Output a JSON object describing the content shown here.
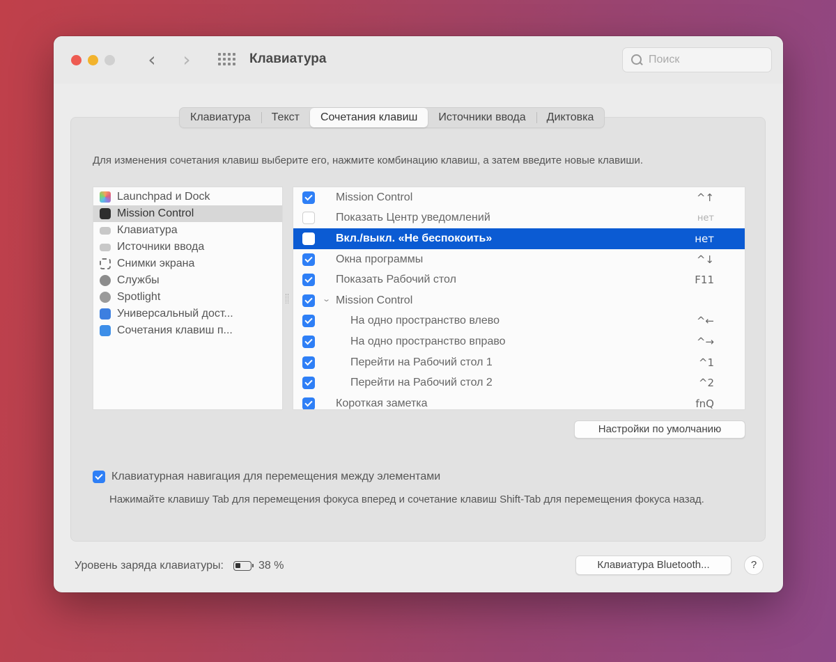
{
  "window": {
    "title": "Клавиатура",
    "search_placeholder": "Поиск"
  },
  "tabs": [
    {
      "label": "Клавиатура",
      "active": false
    },
    {
      "label": "Текст",
      "active": false
    },
    {
      "label": "Сочетания клавиш",
      "active": true
    },
    {
      "label": "Источники ввода",
      "active": false
    },
    {
      "label": "Диктовка",
      "active": false
    }
  ],
  "instructions": "Для изменения сочетания клавиш выберите его, нажмите комбинацию клавиш, а затем введите новые клавиши.",
  "sidebar": {
    "items": [
      {
        "label": "Launchpad и Dock",
        "icon": "launchpad-icon",
        "selected": false
      },
      {
        "label": "Mission Control",
        "icon": "mission-control-icon",
        "selected": true
      },
      {
        "label": "Клавиатура",
        "icon": "keyboard-icon",
        "selected": false
      },
      {
        "label": "Источники ввода",
        "icon": "input-sources-icon",
        "selected": false
      },
      {
        "label": "Снимки экрана",
        "icon": "screenshot-icon",
        "selected": false
      },
      {
        "label": "Службы",
        "icon": "services-icon",
        "selected": false
      },
      {
        "label": "Spotlight",
        "icon": "spotlight-icon",
        "selected": false
      },
      {
        "label": "Универсальный дост...",
        "icon": "accessibility-icon",
        "selected": false
      },
      {
        "label": "Сочетания клавиш п...",
        "icon": "app-shortcuts-icon",
        "selected": false
      }
    ]
  },
  "shortcuts": [
    {
      "label": "Mission Control",
      "key": "^↑",
      "checked": true
    },
    {
      "label": "Показать Центр уведомлений",
      "key": "нет",
      "checked": false
    },
    {
      "label": "Вкл./выкл. «Не беспокоить»",
      "key": "нет",
      "checked": false,
      "selected": true
    },
    {
      "label": "Окна программы",
      "key": "^↓",
      "checked": true
    },
    {
      "label": "Показать Рабочий стол",
      "key": "F11",
      "checked": true
    },
    {
      "label": "Mission Control",
      "key": "",
      "checked": true,
      "group": true
    },
    {
      "label": "На одно пространство влево",
      "key": "^←",
      "checked": true
    },
    {
      "label": "На одно пространство вправо",
      "key": "^→",
      "checked": true
    },
    {
      "label": "Перейти на Рабочий стол 1",
      "key": "^1",
      "checked": true
    },
    {
      "label": "Перейти на Рабочий стол 2",
      "key": "^2",
      "checked": true
    },
    {
      "label": "Короткая заметка",
      "key": "fnQ",
      "checked": true
    }
  ],
  "buttons": {
    "defaults": "Настройки по умолчанию",
    "bluetooth": "Клавиатура Bluetooth...",
    "help": "?"
  },
  "keyboard_navigation": {
    "label": "Клавиатурная навигация для перемещения между элементами",
    "checked": true,
    "description": "Нажимайте клавишу Tab для перемещения фокуса вперед и сочетание клавиш Shift-Tab для перемещения фокуса назад."
  },
  "battery": {
    "label": "Уровень заряда клавиатуры:",
    "value": "38 %"
  }
}
